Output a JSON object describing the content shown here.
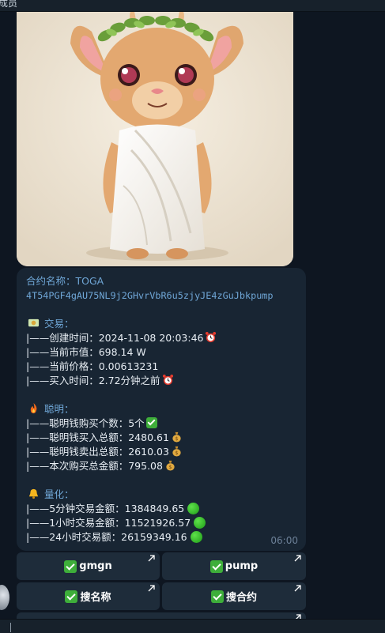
{
  "header": {
    "title": "成员"
  },
  "message": {
    "contract_line": "合约名称：TOGA",
    "address": "4T54PGF4gAU75NL9j2GHvrVbR6u5zjyJE4zGuJbkpump",
    "trade_section": {
      "title": "交易：",
      "icon": "money-icon",
      "rows": [
        {
          "prefix": "|——创建时间：",
          "value": "2024-11-08 20:03:46",
          "icon": "alarm-clock-icon"
        },
        {
          "prefix": "|——当前市值：",
          "value": "698.14 W"
        },
        {
          "prefix": "|——当前价格：",
          "value": "0.00613231"
        },
        {
          "prefix": "|——买入时间：",
          "value": "2.72分钟之前",
          "icon": "alarm-clock-icon"
        }
      ]
    },
    "smart_section": {
      "title": "聪明：",
      "icon": "fire-icon",
      "rows": [
        {
          "prefix": "|——聪明钱购买个数：",
          "value": "5个",
          "icon": "check-mark-icon"
        },
        {
          "prefix": "|——聪明钱买入总额：",
          "value": "2480.61",
          "icon": "money-bag-icon"
        },
        {
          "prefix": "|——聪明钱卖出总额：",
          "value": "2610.03",
          "icon": "money-bag-icon"
        },
        {
          "prefix": "|——本次购买总金额：",
          "value": "795.08",
          "icon": "money-bag-icon"
        }
      ]
    },
    "quant_section": {
      "title": "量化：",
      "icon": "bell-icon",
      "rows": [
        {
          "prefix": "|——5分钟交易金额：",
          "value": "1384849.65",
          "icon": "green-circle-icon"
        },
        {
          "prefix": "|——1小时交易金额：",
          "value": "11521926.57",
          "icon": "green-circle-icon"
        },
        {
          "prefix": "|——24小时交易额：",
          "value": "26159349.16",
          "icon": "green-circle-icon"
        }
      ]
    },
    "time": "06:00"
  },
  "keyboard": {
    "buttons": [
      {
        "label": "gmgn"
      },
      {
        "label": "pump"
      },
      {
        "label": "搜名称"
      },
      {
        "label": "搜合约"
      }
    ]
  },
  "colors": {
    "background": "#0e1621",
    "bubble": "#182533",
    "accent_blue": "#6fa6d6",
    "button": "#1e2c3a"
  }
}
